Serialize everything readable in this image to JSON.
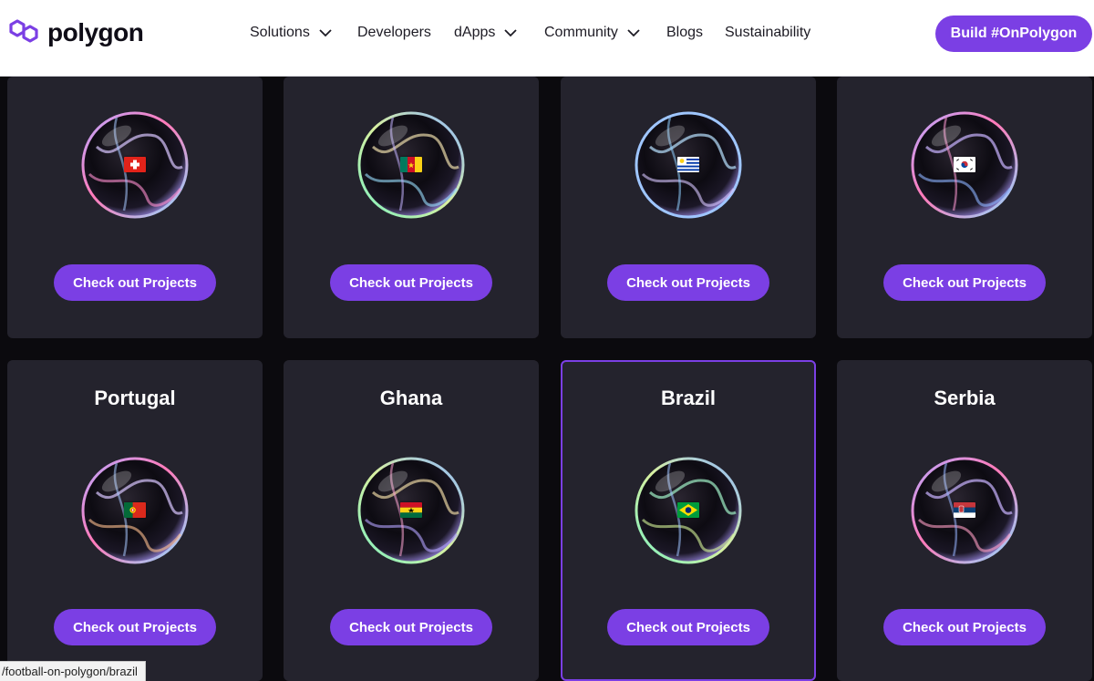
{
  "brand": {
    "name": "polygon",
    "accent": "#7b3fe4"
  },
  "nav": {
    "items": [
      {
        "label": "Solutions",
        "dropdown": true
      },
      {
        "label": "Developers",
        "dropdown": false
      },
      {
        "label": "dApps",
        "dropdown": true
      },
      {
        "label": "Community",
        "dropdown": true
      },
      {
        "label": "Blogs",
        "dropdown": false
      },
      {
        "label": "Sustainability",
        "dropdown": false
      }
    ],
    "cta_label": "Build #OnPolygon"
  },
  "cards_top": [
    {
      "country": "",
      "flag": "switzerland",
      "button_label": "Check out Projects"
    },
    {
      "country": "",
      "flag": "cameroon",
      "button_label": "Check out Projects"
    },
    {
      "country": "",
      "flag": "uruguay",
      "button_label": "Check out Projects"
    },
    {
      "country": "",
      "flag": "south-korea",
      "button_label": "Check out Projects"
    }
  ],
  "cards_bottom": [
    {
      "country": "Portugal",
      "flag": "portugal",
      "button_label": "Check out Projects"
    },
    {
      "country": "Ghana",
      "flag": "ghana",
      "button_label": "Check out Projects"
    },
    {
      "country": "Brazil",
      "flag": "brazil",
      "button_label": "Check out Projects",
      "selected": true
    },
    {
      "country": "Serbia",
      "flag": "serbia",
      "button_label": "Check out Projects"
    }
  ],
  "status_url": "/football-on-polygon/brazil"
}
